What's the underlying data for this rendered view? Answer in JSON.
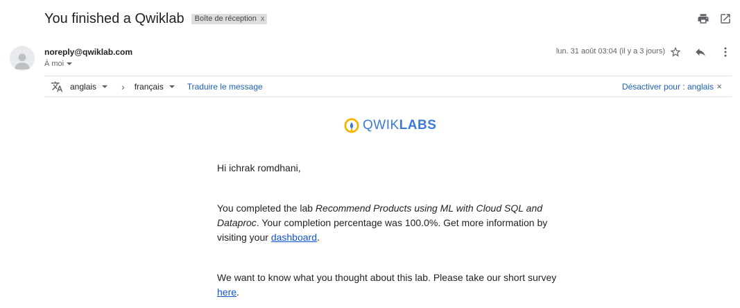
{
  "subject": "You finished a Qwiklab",
  "label": {
    "text": "Boîte de réception",
    "close": "x"
  },
  "sender": {
    "email": "noreply@qwiklab.com",
    "to": "À moi",
    "date": "lun. 31 août 03:04 (il y a 3 jours)"
  },
  "translate": {
    "source_lang": "anglais",
    "target_lang": "français",
    "translate_link": "Traduire le message",
    "disable_link": "Désactiver pour : anglais",
    "close": "×"
  },
  "logo": {
    "part1": "QWIK",
    "part2": "LABS"
  },
  "email_body": {
    "greeting": "Hi ichrak romdhani,",
    "p2_before": "You completed the lab ",
    "p2_lab": "Recommend Products using ML with Cloud SQL and Dataproc",
    "p2_after": ". Your completion percentage was 100.0%. Get more information by visiting your ",
    "p2_link": "dashboard",
    "p2_end": ".",
    "p3_before": "We want to know what you thought about this lab. Please take our short survey ",
    "p3_link": "here",
    "p3_end": "."
  },
  "icons": [
    "print-icon",
    "open-in-new-window-icon",
    "avatar-icon",
    "star-icon",
    "reply-icon",
    "more-vert-icon",
    "translate-icon",
    "chevron-right-icon",
    "qwiklabs-logo-icon"
  ],
  "colors": {
    "link": "#1155cc",
    "qwiklabs_blue": "#3c78d8",
    "qwiklabs_yellow": "#f4b400"
  }
}
